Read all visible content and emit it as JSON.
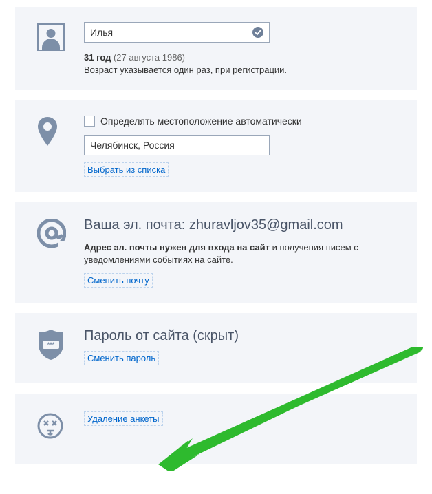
{
  "profile": {
    "name_value": "Илья",
    "age_bold": "31 год",
    "age_paren": "(27 августа 1986)",
    "age_note": "Возраст указывается один раз, при регистрации."
  },
  "location": {
    "checkbox_label": "Определять местоположение автоматически",
    "city_value": "Челябинск, Россия",
    "select_link": "Выбрать из списка"
  },
  "email": {
    "title_prefix": "Ваша эл. почта: ",
    "address": "zhuravljov35@gmail.com",
    "desc_bold": "Адрес эл. почты нужен для входа на сайт",
    "desc_rest": " и получения писем с уведомлениями событиях на сайте.",
    "change_link": "Сменить почту"
  },
  "password": {
    "title": "Пароль от сайта (скрыт)",
    "change_link": "Сменить пароль"
  },
  "delete": {
    "link": "Удаление анкеты"
  }
}
